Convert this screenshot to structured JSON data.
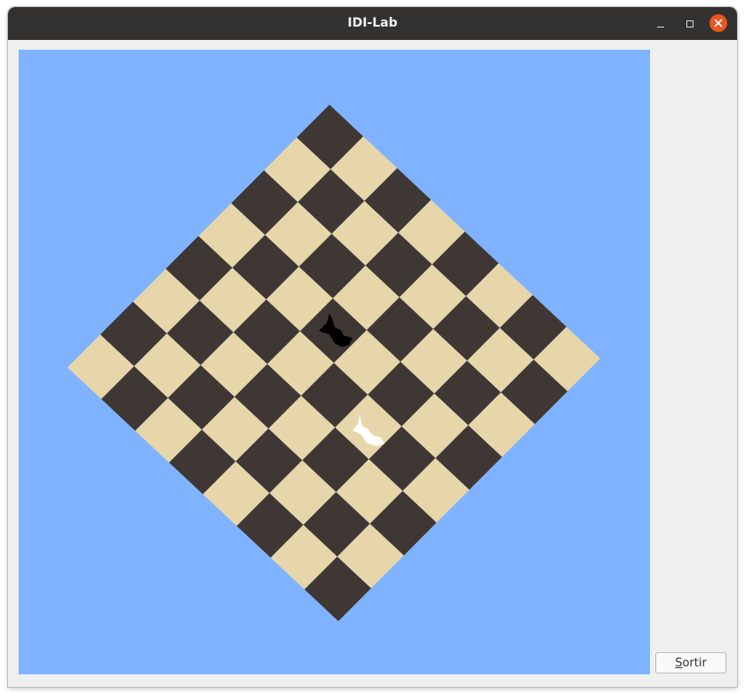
{
  "window": {
    "title": "IDI-Lab",
    "controls": [
      "minimize-icon",
      "maximize-icon",
      "close-icon"
    ]
  },
  "scene": {
    "background_color": "#80b3ff",
    "board": {
      "rows": 8,
      "cols": 8,
      "light_color": "#e7d6aa",
      "dark_color": "#3f3733"
    },
    "pieces": [
      {
        "name": "black-knight-piece",
        "color": "#000000"
      },
      {
        "name": "white-knight-piece",
        "color": "#ffffff"
      }
    ]
  },
  "buttons": {
    "exit_mnemonic": "S",
    "exit_rest": "ortir"
  }
}
